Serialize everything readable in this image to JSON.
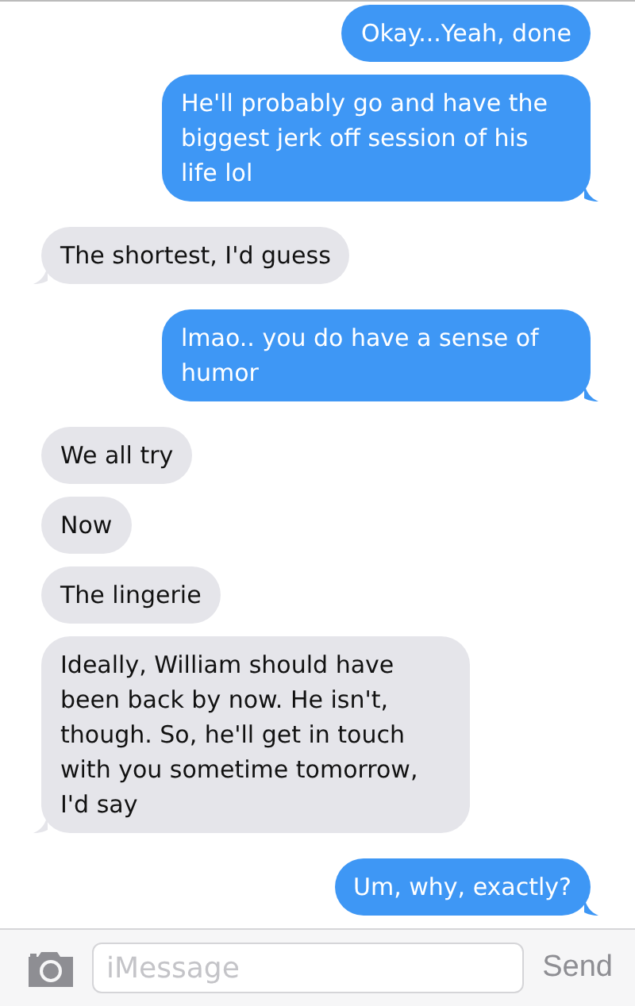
{
  "messages": [
    {
      "kind": "sent",
      "text": "Okay...Yeah, done",
      "tail": false
    },
    {
      "kind": "sent",
      "text": "He'll probably go and have the biggest jerk off session of his life lol",
      "tail": true
    },
    {
      "kind": "received",
      "text": "The shortest, I'd guess",
      "tail": true
    },
    {
      "kind": "sent",
      "text": "lmao.. you do have a sense of humor",
      "tail": true
    },
    {
      "kind": "received",
      "text": "We all try",
      "tail": false
    },
    {
      "kind": "received",
      "text": "Now",
      "tail": false
    },
    {
      "kind": "received",
      "text": "The lingerie",
      "tail": false
    },
    {
      "kind": "received",
      "text": "Ideally, William should have been back by now. He isn't, though. So, he'll get in touch with you sometime tomorrow, I'd say",
      "tail": true
    },
    {
      "kind": "sent",
      "text": "Um, why, exactly?",
      "tail": true
    }
  ],
  "composer": {
    "placeholder": "iMessage",
    "send": "Send"
  }
}
